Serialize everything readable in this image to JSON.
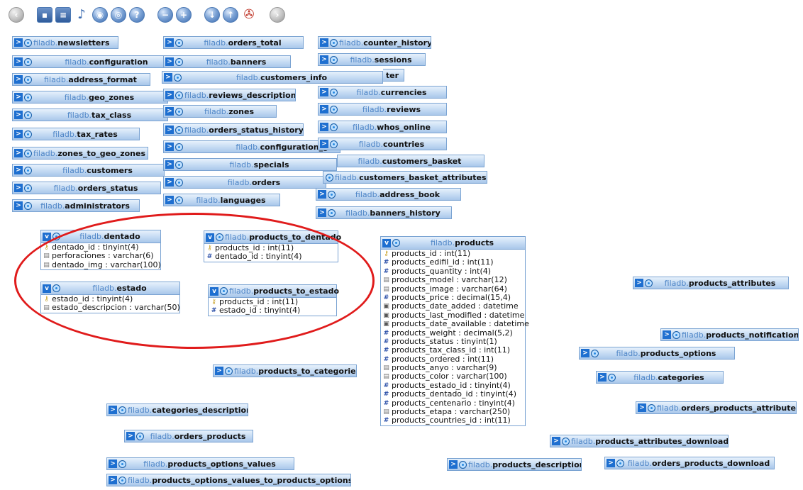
{
  "toolbar": {
    "buttons": [
      {
        "icon": "back-icon"
      },
      {
        "icon": "save-icon"
      },
      {
        "icon": "document-icon"
      },
      {
        "icon": "relation-icon"
      },
      {
        "icon": "circle-icon-1"
      },
      {
        "icon": "circle-icon-2"
      },
      {
        "icon": "help-icon"
      },
      {
        "icon": "zoom-out-icon"
      },
      {
        "icon": "zoom-in-icon"
      },
      {
        "icon": "download-icon"
      },
      {
        "icon": "upload-icon"
      },
      {
        "icon": "pdf-icon"
      },
      {
        "icon": "forward-icon"
      }
    ]
  },
  "db": "filadb.",
  "tables": {
    "newsletters": "newsletters",
    "configuration": "configuration",
    "address_format": "address_format",
    "geo_zones": "geo_zones",
    "tax_class": "tax_class",
    "tax_rates": "tax_rates",
    "zones_to_geo_zones": "zones_to_geo_zones",
    "customers": "customers",
    "orders_status": "orders_status",
    "administrators": "administrators",
    "orders_total": "orders_total",
    "banners": "banners",
    "customers_info": "customers_info",
    "reviews_description": "reviews_description",
    "zones": "zones",
    "orders_status_history": "orders_status_history",
    "configuration_group": "configuration_gro",
    "specials": "specials",
    "orders": "orders",
    "languages": "languages",
    "counter_history": "counter_history",
    "sessions": "sessions",
    "counter": "ter",
    "currencies": "currencies",
    "reviews": "reviews",
    "whos_online": "whos_online",
    "countries": "countries",
    "customers_basket": "customers_basket",
    "customers_basket_attributes": "customers_basket_attributes",
    "address_book": "address_book",
    "banners_history": "banners_history",
    "products_attributes": "products_attributes",
    "products_notifications": "products_notifications",
    "products_options": "products_options",
    "categories": "categories",
    "orders_products_attributes": "orders_products_attributes",
    "products_to_categories": "products_to_categories",
    "categories_description": "categories_description",
    "orders_products": "orders_products",
    "products_options_values": "products_options_values",
    "products_options_values_to_products_options": "products_options_values_to_products_options",
    "products_attributes_download": "products_attributes_download",
    "products_description": "products_description",
    "orders_products_download": "orders_products_download"
  },
  "expanded": {
    "dentado": {
      "name": "dentado",
      "columns": [
        {
          "icon": "key",
          "text": "dentado_id : tinyint(4)"
        },
        {
          "icon": "txt",
          "text": "perforaciones : varchar(6)"
        },
        {
          "icon": "txt",
          "text": "dentado_img : varchar(100)"
        }
      ]
    },
    "estado": {
      "name": "estado",
      "columns": [
        {
          "icon": "key",
          "text": "estado_id : tinyint(4)"
        },
        {
          "icon": "txt",
          "text": "estado_descripcion : varchar(50)"
        }
      ]
    },
    "products_to_dentado": {
      "name": "products_to_dentado",
      "columns": [
        {
          "icon": "key",
          "text": "products_id : int(11)"
        },
        {
          "icon": "num",
          "text": "dentado_id : tinyint(4)"
        }
      ]
    },
    "products_to_estado": {
      "name": "products_to_estado",
      "columns": [
        {
          "icon": "key",
          "text": "products_id : int(11)"
        },
        {
          "icon": "num",
          "text": "estado_id : tinyint(4)"
        }
      ]
    },
    "products": {
      "name": "products",
      "columns": [
        {
          "icon": "key",
          "text": "products_id : int(11)"
        },
        {
          "icon": "num",
          "text": "products_edifil_id : int(11)"
        },
        {
          "icon": "num",
          "text": "products_quantity : int(4)"
        },
        {
          "icon": "txt",
          "text": "products_model : varchar(12)"
        },
        {
          "icon": "txt",
          "text": "products_image : varchar(64)"
        },
        {
          "icon": "num",
          "text": "products_price : decimal(15,4)"
        },
        {
          "icon": "dt",
          "text": "products_date_added : datetime"
        },
        {
          "icon": "dt",
          "text": "products_last_modified : datetime"
        },
        {
          "icon": "dt",
          "text": "products_date_available : datetime"
        },
        {
          "icon": "num",
          "text": "products_weight : decimal(5,2)"
        },
        {
          "icon": "num",
          "text": "products_status : tinyint(1)"
        },
        {
          "icon": "num",
          "text": "products_tax_class_id : int(11)"
        },
        {
          "icon": "num",
          "text": "products_ordered : int(11)"
        },
        {
          "icon": "txt",
          "text": "products_anyo : varchar(9)"
        },
        {
          "icon": "txt",
          "text": "products_color : varchar(100)"
        },
        {
          "icon": "num",
          "text": "products_estado_id : tinyint(4)"
        },
        {
          "icon": "num",
          "text": "products_dentado_id : tinyint(4)"
        },
        {
          "icon": "num",
          "text": "products_centenario : tinyint(4)"
        },
        {
          "icon": "txt",
          "text": "products_etapa : varchar(250)"
        },
        {
          "icon": "num",
          "text": "products_countries_id : int(11)"
        }
      ]
    }
  }
}
